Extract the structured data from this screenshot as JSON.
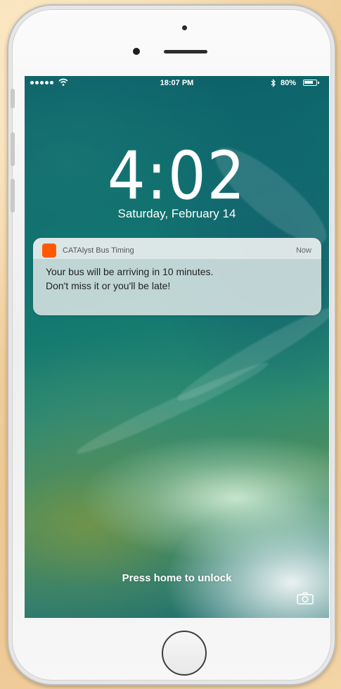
{
  "status_bar": {
    "time": "18:07 PM",
    "battery_percent": "80%",
    "battery_level": 0.8,
    "signal_icon": "signal-dots-icon",
    "wifi_icon": "wifi-icon",
    "bluetooth_icon": "bluetooth-icon"
  },
  "lock_screen": {
    "clock": "4:02",
    "date": "Saturday, February 14",
    "unlock_hint": "Press home to unlock",
    "camera_icon": "camera-icon"
  },
  "notification": {
    "app_name": "CATAlyst Bus Timing",
    "time": "Now",
    "app_icon_color": "#ff5a00",
    "body_lines": [
      "Your bus will be arriving in 10 minutes.",
      "Don't miss it or you'll be late!"
    ]
  }
}
